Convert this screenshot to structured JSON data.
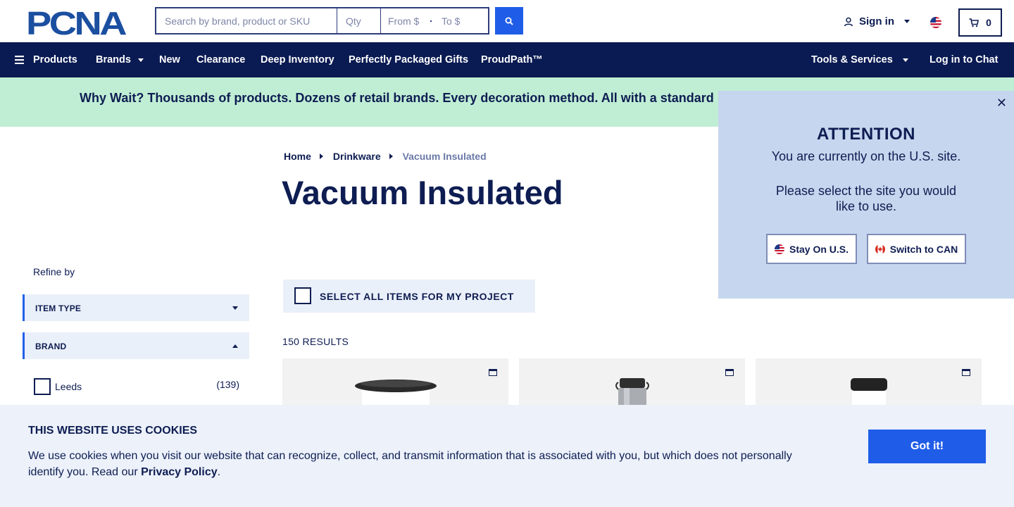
{
  "header": {
    "logo_text": "PCNA",
    "search_placeholder": "Search by brand, product or SKU",
    "qty_placeholder": "Qty",
    "price_from_placeholder": "From $",
    "price_to_placeholder": "To $",
    "signin_label": "Sign in",
    "cart_count": "0"
  },
  "nav": {
    "products": "Products",
    "brands": "Brands",
    "new": "New",
    "clearance": "Clearance",
    "deep_inventory": "Deep Inventory",
    "gifts": "Perfectly Packaged Gifts",
    "proudpath": "ProudPath™",
    "tools": "Tools & Services",
    "chat": "Log in to Chat"
  },
  "promo": {
    "text": "Why Wait? Thousands of products. Dozens of retail brands. Every decoration method. All with a standard"
  },
  "breadcrumb": {
    "home": "Home",
    "category": "Drinkware",
    "current": "Vacuum Insulated"
  },
  "page_title": "Vacuum Insulated",
  "sidebar": {
    "refine_label": "Refine by",
    "facets": [
      {
        "label": "ITEM TYPE",
        "expanded": false
      },
      {
        "label": "BRAND",
        "expanded": true
      }
    ],
    "options": [
      {
        "label": "Leeds",
        "count": "(139)"
      }
    ]
  },
  "results": {
    "select_all_label": "SELECT ALL ITEMS FOR MY PROJECT",
    "count_label": "150 RESULTS"
  },
  "site_modal": {
    "title": "ATTENTION",
    "line1": "You are currently on the U.S. site.",
    "line2": "Please select the site you would like to use.",
    "stay_label": "Stay On U.S.",
    "switch_label": "Switch to CAN",
    "close_symbol": "✕"
  },
  "cookie_banner": {
    "title": "THIS WEBSITE USES COOKIES",
    "text": "We use cookies when you visit our website that can recognize, collect, and transmit information that is associated with you, but which does not personally identify you. Read our ",
    "link_label": "Privacy Policy",
    "text_end": ".",
    "button_label": "Got it!"
  },
  "colors": {
    "navy": "#0a1a52",
    "accent_blue": "#1f5de8",
    "promo_green": "#c0eed4",
    "modal_blue": "#c6d6ee",
    "cookie_bg": "#ecf1fa"
  }
}
